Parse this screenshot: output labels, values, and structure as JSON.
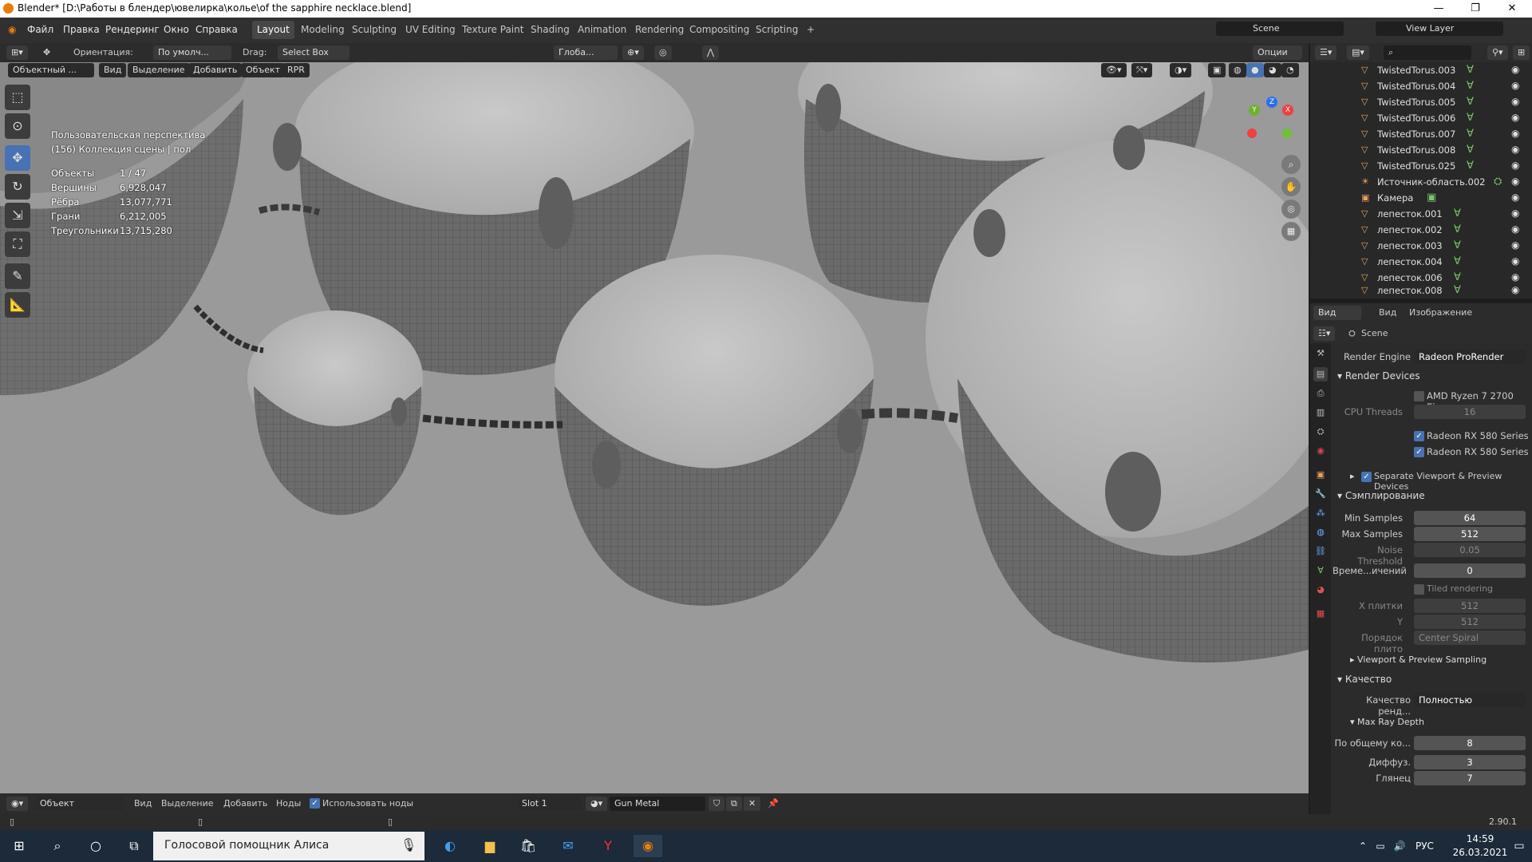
{
  "window": {
    "title": "Blender* [D:\\Работы в блендер\\ювелирка\\колье\\of the sapphire necklace.blend]",
    "minimize": "—",
    "maximize": "❐",
    "close": "✕"
  },
  "menu": {
    "items": [
      "Файл",
      "Правка",
      "Рендеринг",
      "Окно",
      "Справка"
    ]
  },
  "workspaces": [
    "Layout",
    "Modeling",
    "Sculpting",
    "UV Editing",
    "Texture Paint",
    "Shading",
    "Animation",
    "Rendering",
    "Compositing",
    "Scripting"
  ],
  "scene": {
    "name": "Scene",
    "view_layer": "View Layer"
  },
  "viewport_header": {
    "orientation_label": "Ориентация:",
    "orientation_value": "По умолч...",
    "drag_label": "Drag:",
    "drag_value": "Select Box",
    "transform": "Глоба...",
    "options": "Опции"
  },
  "viewport_header2": {
    "mode": "Объектный ...",
    "view": "Вид",
    "select": "Выделение",
    "add": "Добавить",
    "object": "Объект",
    "rpr": "RPR"
  },
  "stats": {
    "view_name": "Пользовательская перспектива",
    "collection": "(156) Коллекция сцены | пол",
    "rows": [
      {
        "label": "Объекты",
        "value": "1 / 47"
      },
      {
        "label": "Вершины",
        "value": "6,928,047"
      },
      {
        "label": "Рёбра",
        "value": "13,077,771"
      },
      {
        "label": "Грани",
        "value": "6,212,005"
      },
      {
        "label": "Треугольники",
        "value": "13,715,280"
      }
    ]
  },
  "outliner": {
    "items": [
      "TwistedTorus.003",
      "TwistedTorus.004",
      "TwistedTorus.005",
      "TwistedTorus.006",
      "TwistedTorus.007",
      "TwistedTorus.008",
      "TwistedTorus.025",
      "Источник-область.002",
      "Камера",
      "лепесток.001",
      "лепесток.002",
      "лепесток.003",
      "лепесток.004",
      "лепесток.006",
      "лепесток.008"
    ]
  },
  "props": {
    "header_view": "Вид",
    "header_view2": "Вид",
    "header_image": "Изображение",
    "scene_label": "Scene",
    "render_engine_label": "Render Engine",
    "render_engine": "Radeon ProRender",
    "render_devices": "Render Devices",
    "cpu": "AMD Ryzen 7 2700 Ei...",
    "cpu_threads_label": "CPU Threads",
    "cpu_threads": "16",
    "gpu1": "Radeon RX 580 Series",
    "gpu2": "Radeon RX 580 Series",
    "separate": "Separate Viewport & Preview Devices",
    "sampling": "Сэмплирование",
    "min_samples_label": "Min Samples",
    "min_samples": "64",
    "max_samples_label": "Max Samples",
    "max_samples": "512",
    "noise_label": "Noise Threshold",
    "noise": "0.05",
    "time_label": "Време...ичений",
    "time": "0",
    "tiled": "Tiled rendering",
    "xtile_label": "X плитки",
    "xtile": "512",
    "ytile_label": "Y",
    "ytile": "512",
    "order_label": "Порядок плито",
    "order": "Center Spiral",
    "viewport_sampling": "Viewport & Preview Sampling",
    "quality": "Качество",
    "quality_label": "Качество ренд...",
    "quality_value": "Полностью",
    "max_ray": "Max Ray Depth",
    "total_label": "По общему ко...",
    "total": "8",
    "diffuse_label": "Диффуз.",
    "diffuse": "3",
    "gloss_label": "Глянец",
    "gloss": "7"
  },
  "node_header": {
    "mode": "Объект",
    "view": "Вид",
    "select": "Выделение",
    "add": "Добавить",
    "nodes": "Ноды",
    "use_nodes": "Использовать ноды",
    "slot": "Slot 1",
    "material": "Gun Metal"
  },
  "status": {
    "version": "2.90.1"
  },
  "taskbar": {
    "search": "Голосовой помощник Алиса",
    "lang": "РУС",
    "time": "14:59",
    "date": "26.03.2021"
  }
}
